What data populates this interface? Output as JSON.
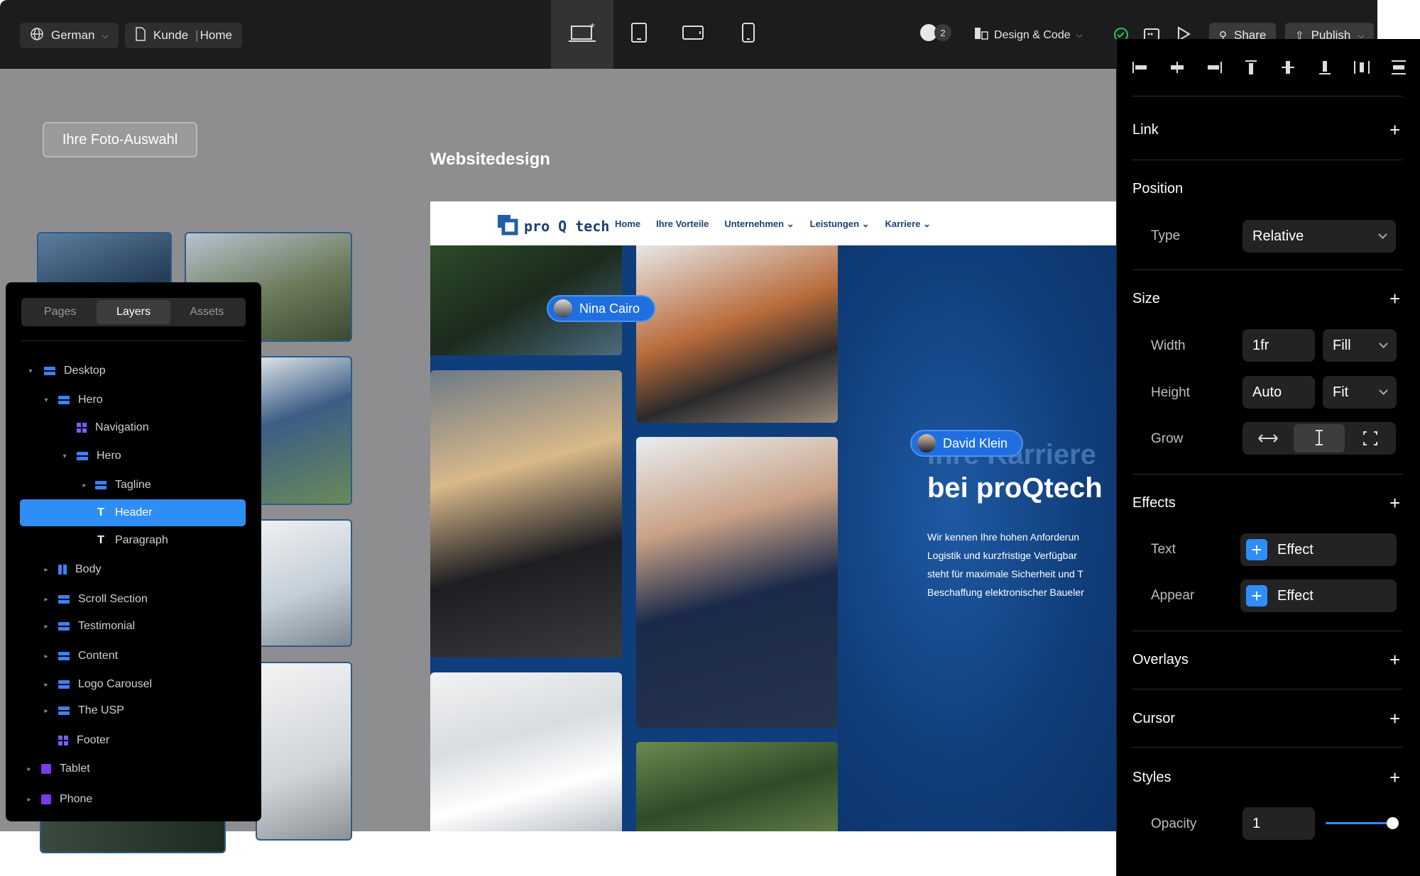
{
  "topbar": {
    "language": "German",
    "page": "Kunde",
    "page_sub": "Home",
    "collaborators_count": "2",
    "mode": "Design & Code",
    "share": "Share",
    "publish": "Publish"
  },
  "canvas": {
    "photo_selection_label": "Ihre Foto-Auswahl",
    "websitedesign_label": "Websitedesign"
  },
  "layers_panel": {
    "tabs": [
      "Pages",
      "Layers",
      "Assets"
    ],
    "items": [
      {
        "label": "Desktop",
        "icon": "stack-icon"
      },
      {
        "label": "Hero",
        "icon": "stack-icon"
      },
      {
        "label": "Navigation",
        "icon": "grid-icon"
      },
      {
        "label": "Hero",
        "icon": "stack-icon"
      },
      {
        "label": "Tagline",
        "icon": "stack-icon"
      },
      {
        "label": "Header",
        "icon": "text-icon"
      },
      {
        "label": "Paragraph",
        "icon": "text-icon"
      },
      {
        "label": "Body",
        "icon": "columns-icon"
      },
      {
        "label": "Scroll Section",
        "icon": "stack-icon"
      },
      {
        "label": "Testimonial",
        "icon": "stack-icon"
      },
      {
        "label": "Content",
        "icon": "stack-icon"
      },
      {
        "label": "Logo Carousel",
        "icon": "stack-icon"
      },
      {
        "label": "The USP",
        "icon": "stack-icon"
      },
      {
        "label": "Footer",
        "icon": "grid-icon"
      },
      {
        "label": "Tablet",
        "icon": "frame-icon"
      },
      {
        "label": "Phone",
        "icon": "frame-icon"
      }
    ]
  },
  "site": {
    "logo_text": "pro Q tech",
    "nav": [
      "Home",
      "Ihre Vorteile",
      "Unternehmen",
      "Leistungen",
      "Karriere"
    ],
    "cursor_user_1": "Nina Cairo",
    "cursor_user_2": "David Klein",
    "headline_partial": "Ihre Karriere",
    "headline_line2": "bei proQtech",
    "body_lines": [
      "Wir kennen Ihre hohen Anforderun",
      "Logistik und kurzfristige Verfügbar",
      "steht für maximale Sicherheit und T",
      "Beschaffung elektronischer Baueler"
    ]
  },
  "props_panel": {
    "link": "Link",
    "position": "Position",
    "type_label": "Type",
    "type_value": "Relative",
    "size": "Size",
    "width_label": "Width",
    "width_value": "1fr",
    "width_mode": "Fill",
    "height_label": "Height",
    "height_value": "Auto",
    "height_mode": "Fit",
    "grow_label": "Grow",
    "effects": "Effects",
    "text_label": "Text",
    "appear_label": "Appear",
    "effect_btn": "Effect",
    "overlays": "Overlays",
    "cursor": "Cursor",
    "styles": "Styles",
    "opacity_label": "Opacity",
    "opacity_value": "1"
  },
  "colors": {
    "accent": "#2f8ef5",
    "site_blue": "#12468a",
    "topbar": "#1c1c1e"
  }
}
